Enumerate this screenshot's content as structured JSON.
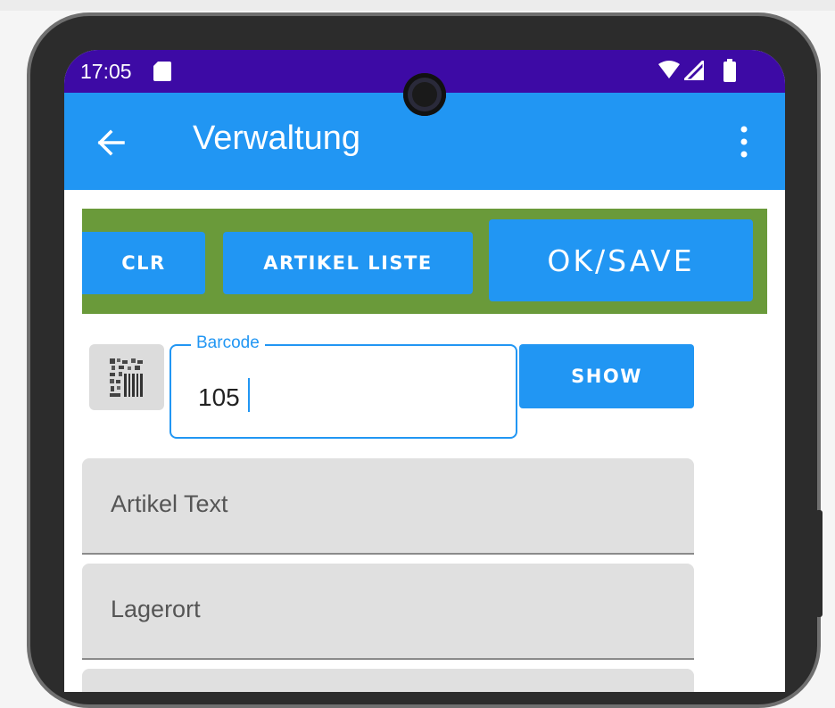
{
  "status_bar": {
    "time": "17:05",
    "icons": [
      "sd-card-icon",
      "wifi-icon",
      "signal-icon",
      "battery-icon"
    ]
  },
  "app_bar": {
    "title": "Verwaltung",
    "back_icon": "arrow-left-icon",
    "menu_icon": "more-vertical-icon"
  },
  "toolbar": {
    "clr_label": "CLR",
    "artikel_liste_label": "ARTIKEL LISTE",
    "ok_save_label": "OK/SAVE"
  },
  "barcode": {
    "label": "Barcode",
    "value": "105",
    "scan_icon": "barcode-scan-icon",
    "show_label": "SHOW"
  },
  "fields": {
    "artikel_text_placeholder": "Artikel Text",
    "lagerort_placeholder": "Lagerort"
  },
  "colors": {
    "status_bar": "#3d0aa5",
    "primary": "#2196f3",
    "toolbar_bg": "#6a9a3a",
    "field_bg": "#e0e0e0"
  }
}
